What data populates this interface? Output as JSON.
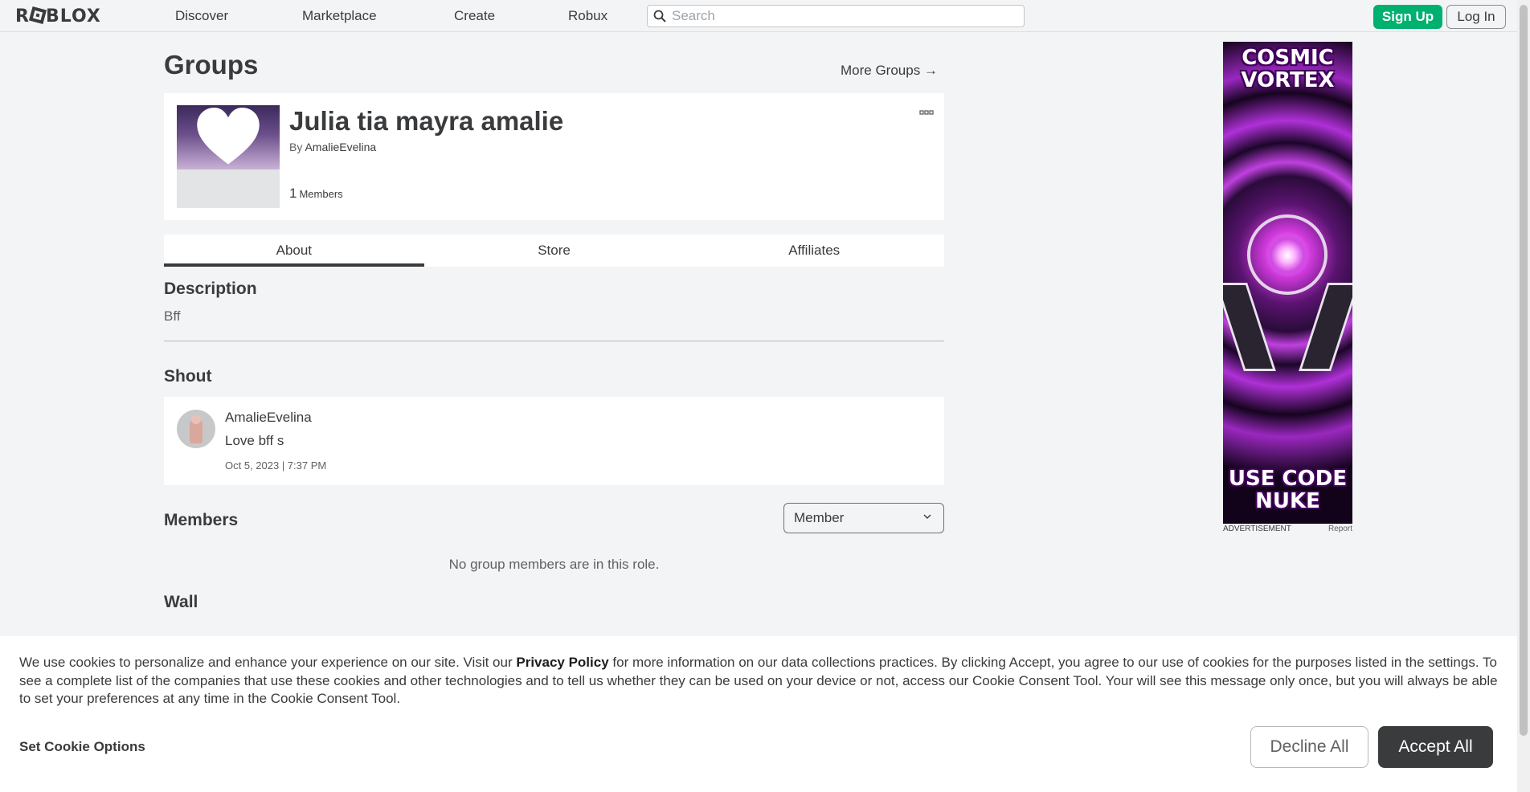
{
  "nav": {
    "logo": "ROBLOX",
    "links": [
      "Discover",
      "Marketplace",
      "Create",
      "Robux"
    ],
    "search_placeholder": "Search",
    "signup": "Sign Up",
    "login": "Log In"
  },
  "page": {
    "title": "Groups",
    "more_groups": "More Groups →"
  },
  "group": {
    "name": "Julia tia mayra amalie",
    "by_label": "By",
    "owner": "AmalieEvelina",
    "member_count": "1",
    "members_label": "Members",
    "menu_icon": "ellipsis-icon"
  },
  "tabs": [
    "About",
    "Store",
    "Affiliates"
  ],
  "active_tab": "About",
  "description": {
    "title": "Description",
    "text": "Bff"
  },
  "shout": {
    "title": "Shout",
    "user": "AmalieEvelina",
    "body": "Love bff s",
    "date": "Oct 5, 2023 | 7:37 PM"
  },
  "members": {
    "title": "Members",
    "role": "Member",
    "empty": "No group members are in this role."
  },
  "wall": {
    "title": "Wall"
  },
  "ad": {
    "headline_top": "COSMIC VORTEX",
    "headline_bottom": "USE CODE NUKE",
    "label": "ADVERTISEMENT",
    "report": "Report"
  },
  "cookie": {
    "text_before": "We use cookies to personalize and enhance your experience on our site. Visit our ",
    "privacy_link": "Privacy Policy",
    "text_after": " for more information on our data collections practices. By clicking Accept, you agree to our use of cookies for the purposes listed in the settings. To see a complete list of the companies that use these cookies and other technologies and to tell us whether they can be used on your device or not, access our Cookie Consent Tool. Your will see this message only once, but you will always be able to set your preferences at any time in the Cookie Consent Tool.",
    "options": "Set Cookie Options",
    "decline": "Decline All",
    "accept": "Accept All"
  },
  "colors": {
    "accent_green": "#00b06f",
    "text_dark": "#393b3d",
    "background": "#f2f4f5"
  }
}
